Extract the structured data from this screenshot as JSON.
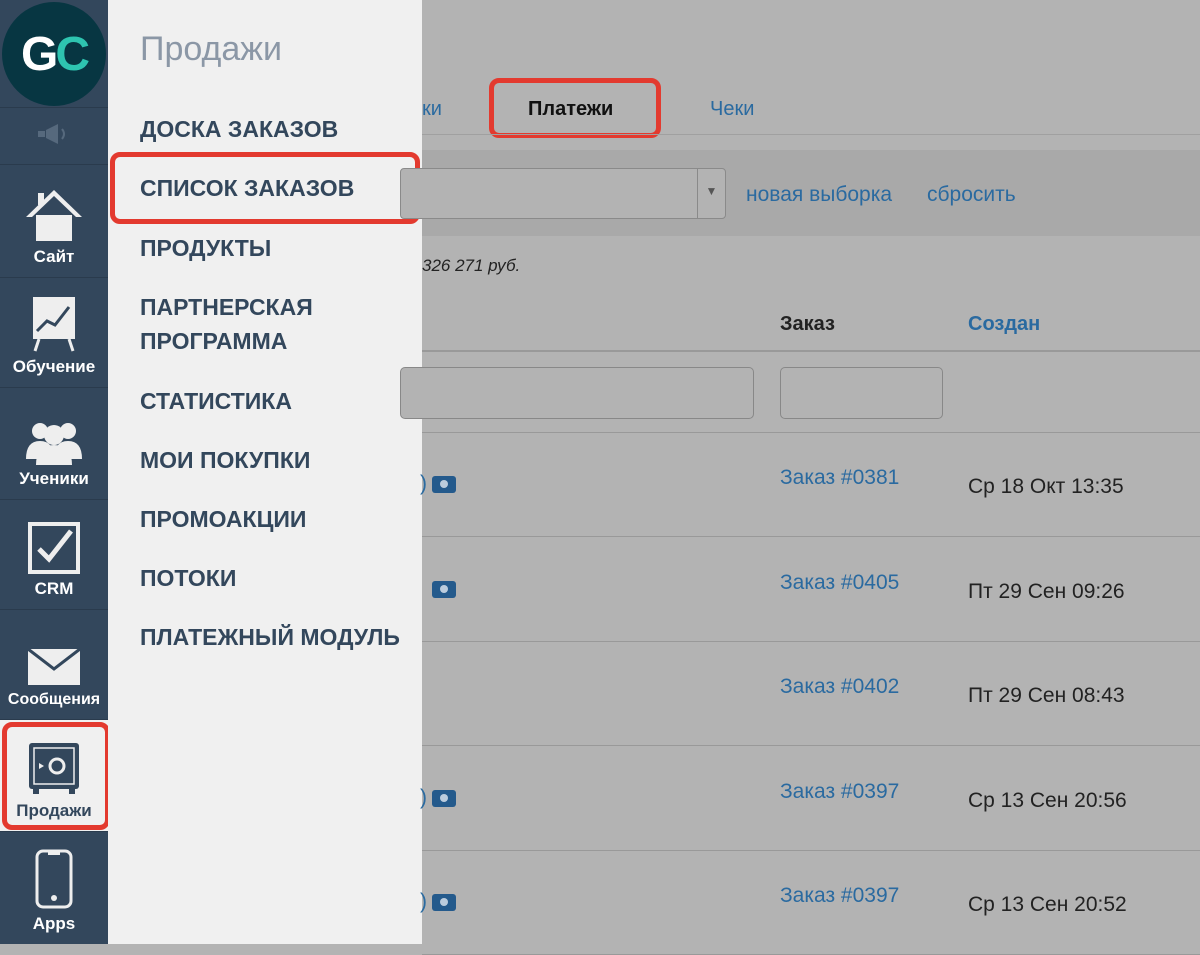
{
  "sidebar": {
    "logo": "GC",
    "items": [
      {
        "label": "Сайт",
        "icon": "home-icon"
      },
      {
        "label": "Обучение",
        "icon": "chart-board-icon"
      },
      {
        "label": "Ученики",
        "icon": "users-icon"
      },
      {
        "label": "CRM",
        "icon": "checkbox-icon"
      },
      {
        "label": "Сообщения",
        "icon": "envelope-icon"
      },
      {
        "label": "Продажи",
        "icon": "safe-icon",
        "active": true
      },
      {
        "label": "Apps",
        "icon": "phone-icon"
      }
    ]
  },
  "menu": {
    "title": "Продажи",
    "items": [
      "ДОСКА ЗАКАЗОВ",
      "СПИСОК ЗАКАЗОВ",
      "ПРОДУКТЫ",
      "ПАРТНЕРСКАЯ ПРОГРАММА",
      "СТАТИСТИКА",
      "МОИ ПОКУПКИ",
      "ПРОМОАКЦИИ",
      "ПОТОКИ",
      "ПЛАТЕЖНЫЙ МОДУЛЬ"
    ],
    "highlighted": "СПИСОК ЗАКАЗОВ"
  },
  "tabs": [
    "ки",
    "Платежи",
    "Чеки"
  ],
  "filter": {
    "new_selection": "новая выборка",
    "reset": "сбросить"
  },
  "summary": "326 271 руб.",
  "table": {
    "headers": {
      "order": "Заказ",
      "created": "Создан"
    },
    "rows": [
      {
        "order": "Заказ #0381",
        "created": "Ср 18 Окт 13:35",
        "paren": ")",
        "money": true
      },
      {
        "order": "Заказ #0405",
        "created": "Пт 29 Сен 09:26",
        "paren": "",
        "money": true
      },
      {
        "order": "Заказ #0402",
        "created": "Пт 29 Сен 08:43",
        "paren": "",
        "money": false
      },
      {
        "order": "Заказ #0397",
        "created": "Ср 13 Сен 20:56",
        "paren": ")",
        "money": true
      },
      {
        "order": "Заказ #0397",
        "created": "Ср 13 Сен 20:52",
        "paren": ")",
        "money": true
      }
    ]
  },
  "colors": {
    "sidebar": "#33475c",
    "highlight": "#e33a2f",
    "link": "#2a6aa0"
  }
}
